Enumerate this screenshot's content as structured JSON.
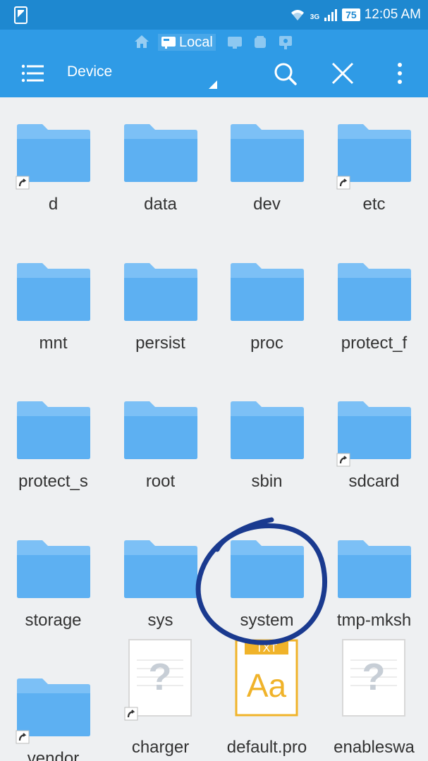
{
  "status_bar": {
    "network_type": "3G",
    "battery_level": "75",
    "time": "12:05 AM"
  },
  "app_bar": {
    "location_label": "Local",
    "title": "Device"
  },
  "files": [
    {
      "name": "d",
      "type": "folder",
      "shortcut": true
    },
    {
      "name": "data",
      "type": "folder",
      "shortcut": false
    },
    {
      "name": "dev",
      "type": "folder",
      "shortcut": false
    },
    {
      "name": "etc",
      "type": "folder",
      "shortcut": true
    },
    {
      "name": "mnt",
      "type": "folder",
      "shortcut": false
    },
    {
      "name": "persist",
      "type": "folder",
      "shortcut": false
    },
    {
      "name": "proc",
      "type": "folder",
      "shortcut": false
    },
    {
      "name": "protect_f",
      "type": "folder",
      "shortcut": false
    },
    {
      "name": "protect_s",
      "type": "folder",
      "shortcut": false
    },
    {
      "name": "root",
      "type": "folder",
      "shortcut": false
    },
    {
      "name": "sbin",
      "type": "folder",
      "shortcut": false
    },
    {
      "name": "sdcard",
      "type": "folder",
      "shortcut": true
    },
    {
      "name": "storage",
      "type": "folder",
      "shortcut": false
    },
    {
      "name": "sys",
      "type": "folder",
      "shortcut": false
    },
    {
      "name": "system",
      "type": "folder",
      "shortcut": false
    },
    {
      "name": "tmp-mksh",
      "type": "folder",
      "shortcut": false
    },
    {
      "name": "vendor",
      "type": "folder",
      "shortcut": true
    },
    {
      "name": "charger",
      "type": "unknown-file",
      "shortcut": true
    },
    {
      "name": "default.pro",
      "type": "txt-file",
      "shortcut": false,
      "badge": "TXT",
      "glyph": "Aa"
    },
    {
      "name": "enableswa",
      "type": "unknown-file",
      "shortcut": false
    }
  ],
  "colors": {
    "status_bar": "#1e88d0",
    "app_bar": "#2f9be6",
    "folder": "#5db0f2",
    "folder_tab": "#7cc0f6",
    "annotation_circle": "#1a3a8f"
  },
  "icons": {
    "menu": "menu-icon",
    "search": "search-icon",
    "close": "close-icon",
    "more": "more-vertical-icon",
    "home": "home-icon"
  }
}
